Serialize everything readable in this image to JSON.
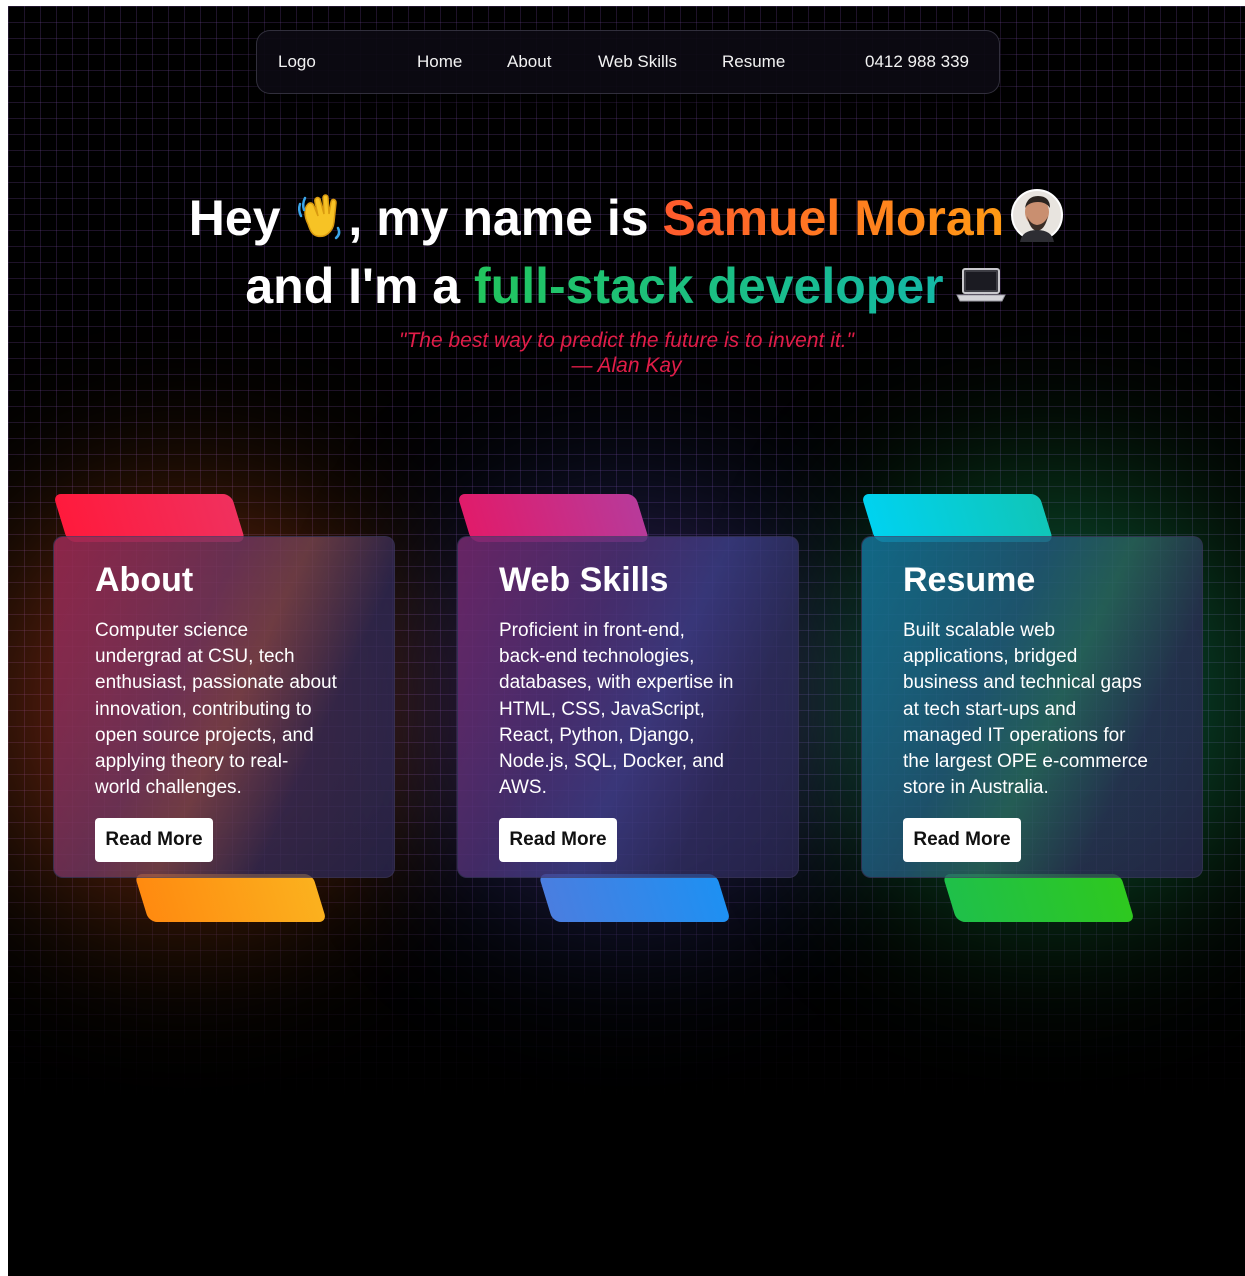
{
  "nav": {
    "logo": "Logo",
    "links": [
      "Home",
      "About",
      "Web Skills",
      "Resume"
    ],
    "phone": "0412 988 339"
  },
  "hero": {
    "line1_prefix": "Hey ",
    "line1_mid": ", my name is ",
    "name": "Samuel Moran",
    "line2_prefix": "and I'm a ",
    "role": "full-stack developer",
    "wave_icon": "waving-hand-icon",
    "avatar_icon": "profile-avatar",
    "laptop_icon": "laptop-icon"
  },
  "quote": {
    "text": "\"The best way to predict the future is to invent it.\"",
    "author": "— Alan Kay"
  },
  "cards": [
    {
      "title": "About",
      "lines": [
        "Computer science",
        "undergrad at CSU, tech",
        "enthusiast, passionate about",
        "innovation, contributing to",
        "open source projects, and",
        "applying theory to real-",
        "world challenges."
      ],
      "button": "Read More",
      "top_color": "#f5164b",
      "bottom_color": "#f99a12"
    },
    {
      "title": "Web Skills",
      "lines": [
        "Proficient in front-end,",
        "back-end technologies,",
        "databases, with expertise in",
        "HTML, CSS, JavaScript,",
        "React, Python, Django,",
        "Node.js, SQL, Docker, and",
        "AWS."
      ],
      "button": "Read More",
      "top_color": "#d6206f",
      "bottom_color": "#1f8bf0"
    },
    {
      "title": "Resume",
      "lines": [
        "Built scalable web",
        "applications, bridged",
        "business and technical gaps",
        "at tech start-ups and",
        "managed IT operations for",
        "the largest OPE e-commerce",
        "store in Australia."
      ],
      "button": "Read More",
      "top_color": "#06c9e8",
      "bottom_color": "#22c22e"
    }
  ]
}
